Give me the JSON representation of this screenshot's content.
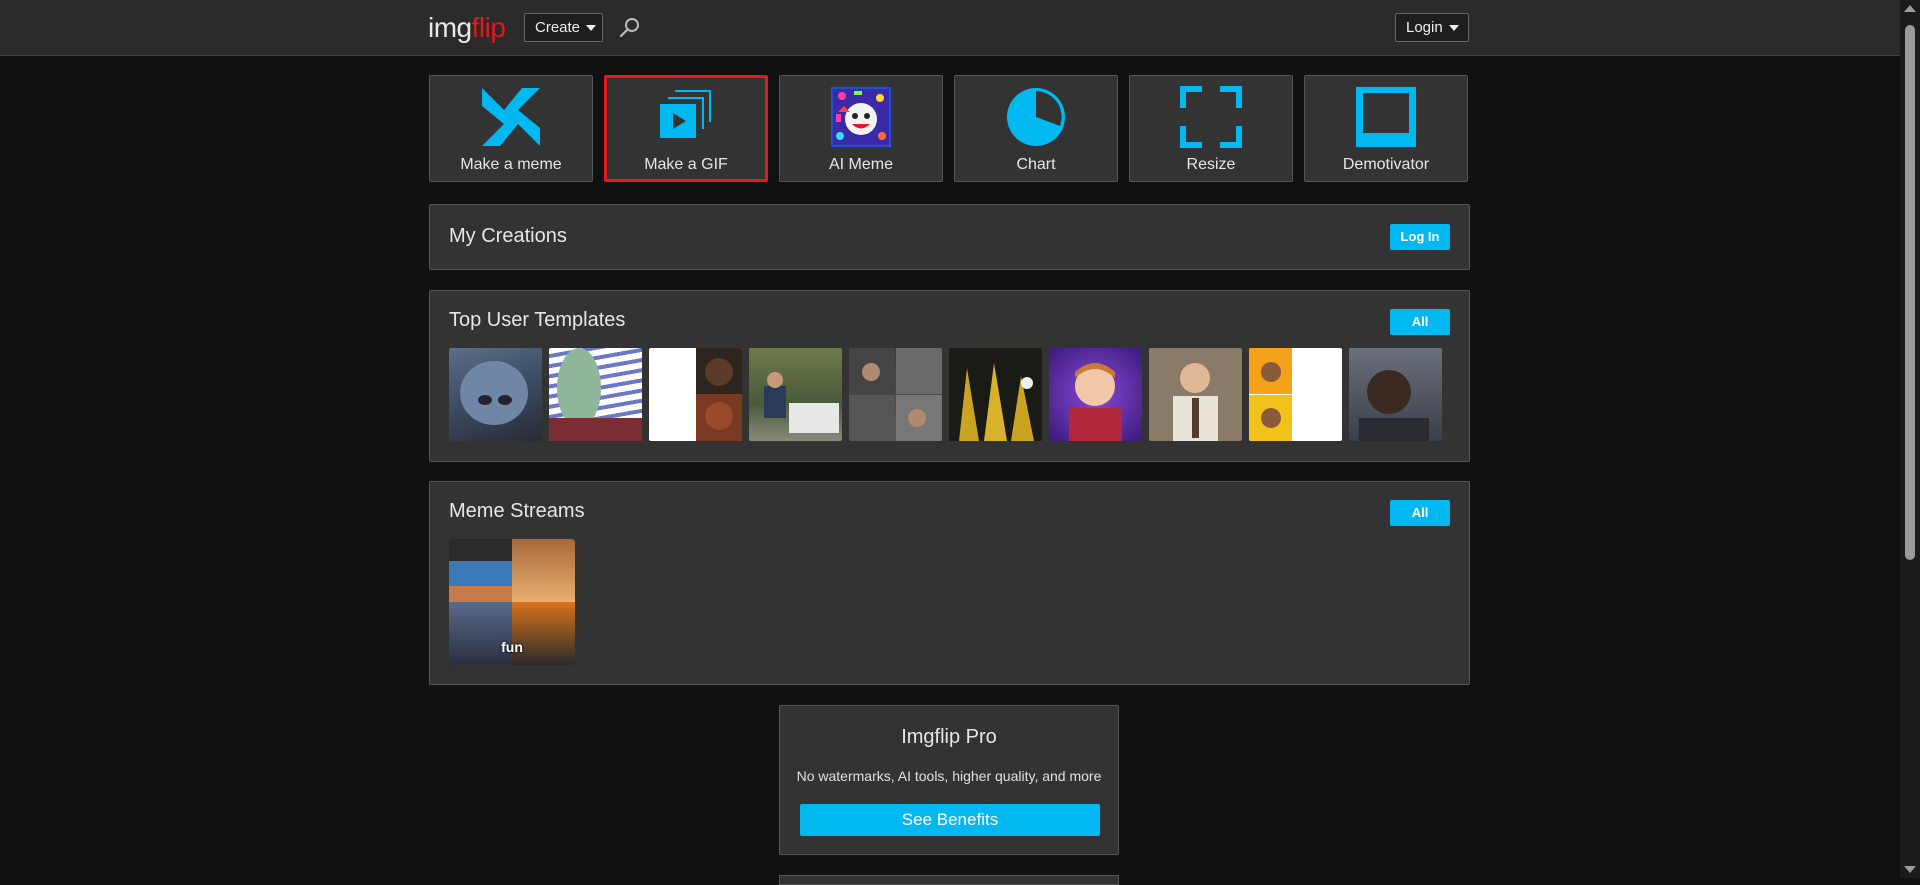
{
  "header": {
    "logo_img": "img",
    "logo_flip": "flip",
    "create_label": "Create",
    "login_label": "Login"
  },
  "tools": [
    {
      "label": "Make a meme",
      "icon": "pinwheel-icon"
    },
    {
      "label": "Make a GIF",
      "icon": "gif-stack-icon",
      "selected": true
    },
    {
      "label": "AI Meme",
      "icon": "ai-meme-icon"
    },
    {
      "label": "Chart",
      "icon": "pie-chart-icon"
    },
    {
      "label": "Resize",
      "icon": "resize-icon"
    },
    {
      "label": "Demotivator",
      "icon": "demotivator-icon"
    }
  ],
  "my_creations": {
    "title": "My Creations",
    "button": "Log In"
  },
  "top_templates": {
    "title": "Top User Templates",
    "button": "All",
    "count": 10
  },
  "meme_streams": {
    "title": "Meme Streams",
    "button": "All",
    "stream_label": "fun"
  },
  "pro": {
    "title": "Imgflip Pro",
    "description": "No watermarks, AI tools, higher quality, and more",
    "button": "See Benefits"
  },
  "colors": {
    "accent": "#02b8f0",
    "logo_red": "#e0191e",
    "selection": "#e01b22",
    "background": "#111111",
    "panel": "#333333"
  }
}
